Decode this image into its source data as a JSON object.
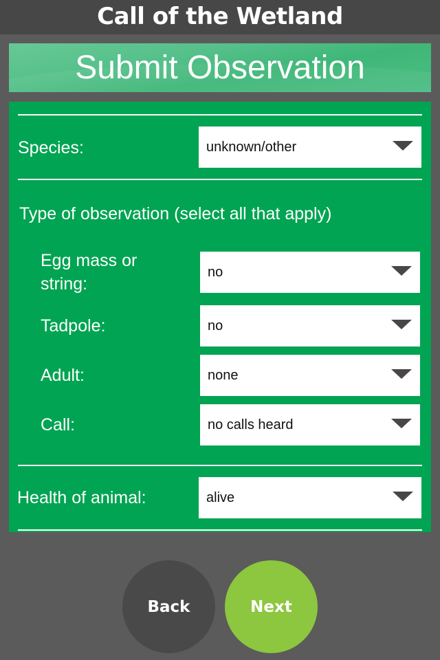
{
  "header": {
    "app_title": "Call of the Wetland"
  },
  "banner": {
    "title": "Submit Observation"
  },
  "form": {
    "species": {
      "label": "Species:",
      "value": "unknown/other"
    },
    "observation_type": {
      "heading": "Type of observation (select all that apply)",
      "egg_mass": {
        "label": "Egg mass or string:",
        "value": "no"
      },
      "tadpole": {
        "label": "Tadpole:",
        "value": "no"
      },
      "adult": {
        "label": "Adult:",
        "value": "none"
      },
      "call": {
        "label": "Call:",
        "value": "no calls heard"
      }
    },
    "health": {
      "label": "Health of animal:",
      "value": "alive"
    }
  },
  "nav": {
    "back_label": "Back",
    "next_label": "Next"
  },
  "colors": {
    "panel": "#00a452",
    "banner": "#4cbd84",
    "next": "#8dc63f",
    "back": "#4a494a",
    "background": "#5b5b5b"
  }
}
